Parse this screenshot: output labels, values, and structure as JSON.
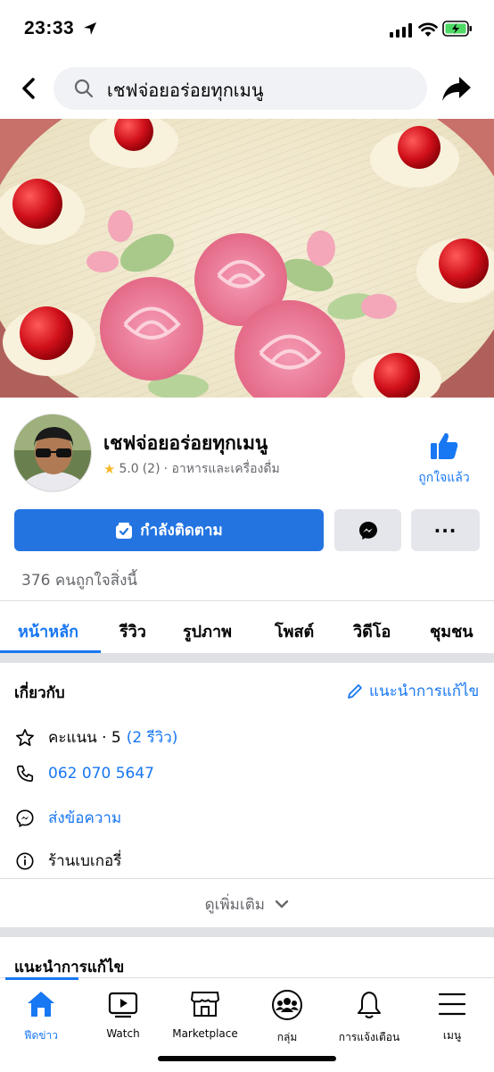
{
  "status_bar": {
    "time": "23:33"
  },
  "header": {
    "search_text": "เชฟจ่อยอร่อยทุกเมนู"
  },
  "profile": {
    "name": "เชฟจ่อยอร่อยทุกเมนู",
    "rating": "5.0",
    "review_count": "(2)",
    "category": "· อาหารและเครื่องดื่ม",
    "liked_label": "ถูกใจแล้ว"
  },
  "actions": {
    "follow_label": "กำลังติดตาม"
  },
  "likes_text": "376 คนถูกใจสิ่งนี้",
  "tabs": [
    {
      "label": "หน้าหลัก"
    },
    {
      "label": "รีวิว"
    },
    {
      "label": "รูปภาพ"
    },
    {
      "label": "โพสต์"
    },
    {
      "label": "วิดีโอ"
    },
    {
      "label": "ชุมชน"
    }
  ],
  "about": {
    "title": "เกี่ยวกับ",
    "suggest_edit": "แนะนำการแก้ไข",
    "rating_prefix": "คะแนน · 5",
    "rating_link": "(2 รีวิว)",
    "phone": "062 070 5647",
    "send_message": "ส่งข้อความ",
    "category": "ร้านเบเกอรี่",
    "see_more": "ดูเพิ่มเติม"
  },
  "suggest_section": {
    "title": "แนะนำการแก้ไข"
  },
  "bottom_nav": [
    {
      "label": "ฟีดข่าว",
      "icon": "home-icon"
    },
    {
      "label": "Watch",
      "icon": "watch-icon"
    },
    {
      "label": "Marketplace",
      "icon": "marketplace-icon"
    },
    {
      "label": "กลุ่ม",
      "icon": "groups-icon"
    },
    {
      "label": "การแจ้งเตือน",
      "icon": "bell-icon"
    },
    {
      "label": "เมนู",
      "icon": "menu-icon"
    }
  ],
  "colors": {
    "accent": "#1877f2",
    "follow_button": "#2374e1",
    "secondary_button": "#e4e6eb",
    "star": "#f7b928"
  }
}
